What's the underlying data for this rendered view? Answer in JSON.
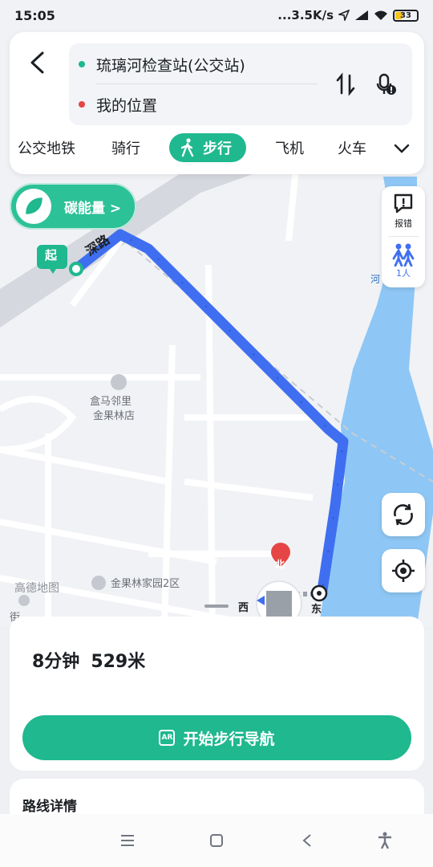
{
  "status_bar": {
    "time": "15:05",
    "network_speed": "...3.5K/s",
    "battery_level": "33",
    "battery_fraction": 0.33
  },
  "route_inputs": {
    "origin": "琉璃河检查站(公交站)",
    "destination": "我的位置"
  },
  "modes": [
    {
      "label": "公交地铁",
      "active": false
    },
    {
      "label": "骑行",
      "active": false
    },
    {
      "label": "步行",
      "active": true
    },
    {
      "label": "飞机",
      "active": false
    },
    {
      "label": "火车",
      "active": false
    }
  ],
  "carbon": {
    "label": "碳能量 >"
  },
  "side_panel": {
    "report_label": "报错",
    "people_label": "1人"
  },
  "map": {
    "start_label": "起",
    "road_label": "深路",
    "poi_name_line1": "盒马邻里",
    "poi_name_line2": "金果林店",
    "community": "金果林家园2区",
    "street_partial": "街",
    "brand": "高德地图",
    "compass_north": "北",
    "compass_west": "西",
    "compass_east": "东",
    "river_label": "河"
  },
  "route_summary": {
    "duration": "8分钟",
    "distance": "529米"
  },
  "navigation_button": {
    "label": "开始步行导航",
    "ar_icon": "AR"
  },
  "route_detail": {
    "title": "路线详情"
  },
  "colors": {
    "accent": "#1fb88f",
    "route": "#3f6ff0",
    "river": "#8ec7f5",
    "start_marker": "#1fb88f",
    "north_marker": "#e64545"
  }
}
